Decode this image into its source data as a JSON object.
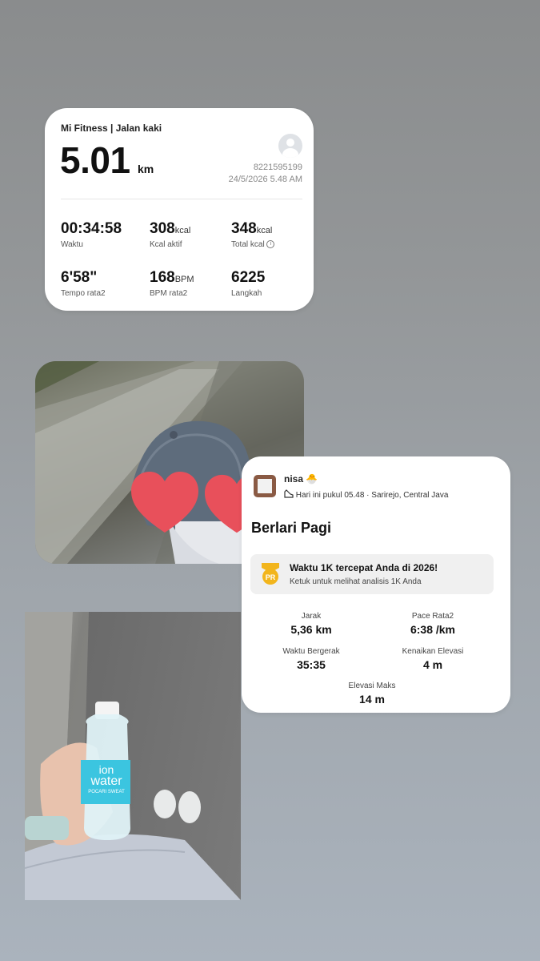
{
  "mi_fitness": {
    "app_title": "Mi Fitness | Jalan kaki",
    "distance": "5.01",
    "distance_unit": "km",
    "user_id": "8221595199",
    "datetime": "24/5/2026 5.48 AM",
    "stats": [
      {
        "value": "00:34:58",
        "unit": "",
        "label": "Waktu"
      },
      {
        "value": "308",
        "unit": "kcal",
        "label": "Kcal aktif"
      },
      {
        "value": "348",
        "unit": "kcal",
        "label": "Total kcal"
      },
      {
        "value": "6'58\"",
        "unit": "",
        "label": "Tempo rata2"
      },
      {
        "value": "168",
        "unit": "BPM",
        "label": "BPM rata2"
      },
      {
        "value": "6225",
        "unit": "",
        "label": "Langkah"
      }
    ]
  },
  "strava": {
    "user_name": "nisa 🐣",
    "meta": "Hari ini pukul 05.48 · Sarirejo, Central Java",
    "activity_title": "Berlari Pagi",
    "pr_badge": "PR",
    "pr_title": "Waktu 1K tercepat Anda di 2026!",
    "pr_subtitle": "Ketuk untuk melihat analisis 1K Anda",
    "stats": [
      {
        "label": "Jarak",
        "value": "5,36 km"
      },
      {
        "label": "Pace Rata2",
        "value": "6:38 /km"
      },
      {
        "label": "Waktu Bergerak",
        "value": "35:35"
      },
      {
        "label": "Kenaikan Elevasi",
        "value": "4 m"
      },
      {
        "label": "Elevasi Maks",
        "value": "14 m"
      }
    ]
  },
  "photo_bottle": {
    "brand_line1": "ion",
    "brand_line2": "water",
    "brand_line3": "POCARI SWEAT"
  },
  "colors": {
    "heart": "#e8505b",
    "pr_gold": "#f2b51c",
    "bottle_label": "#3bc5e0"
  }
}
